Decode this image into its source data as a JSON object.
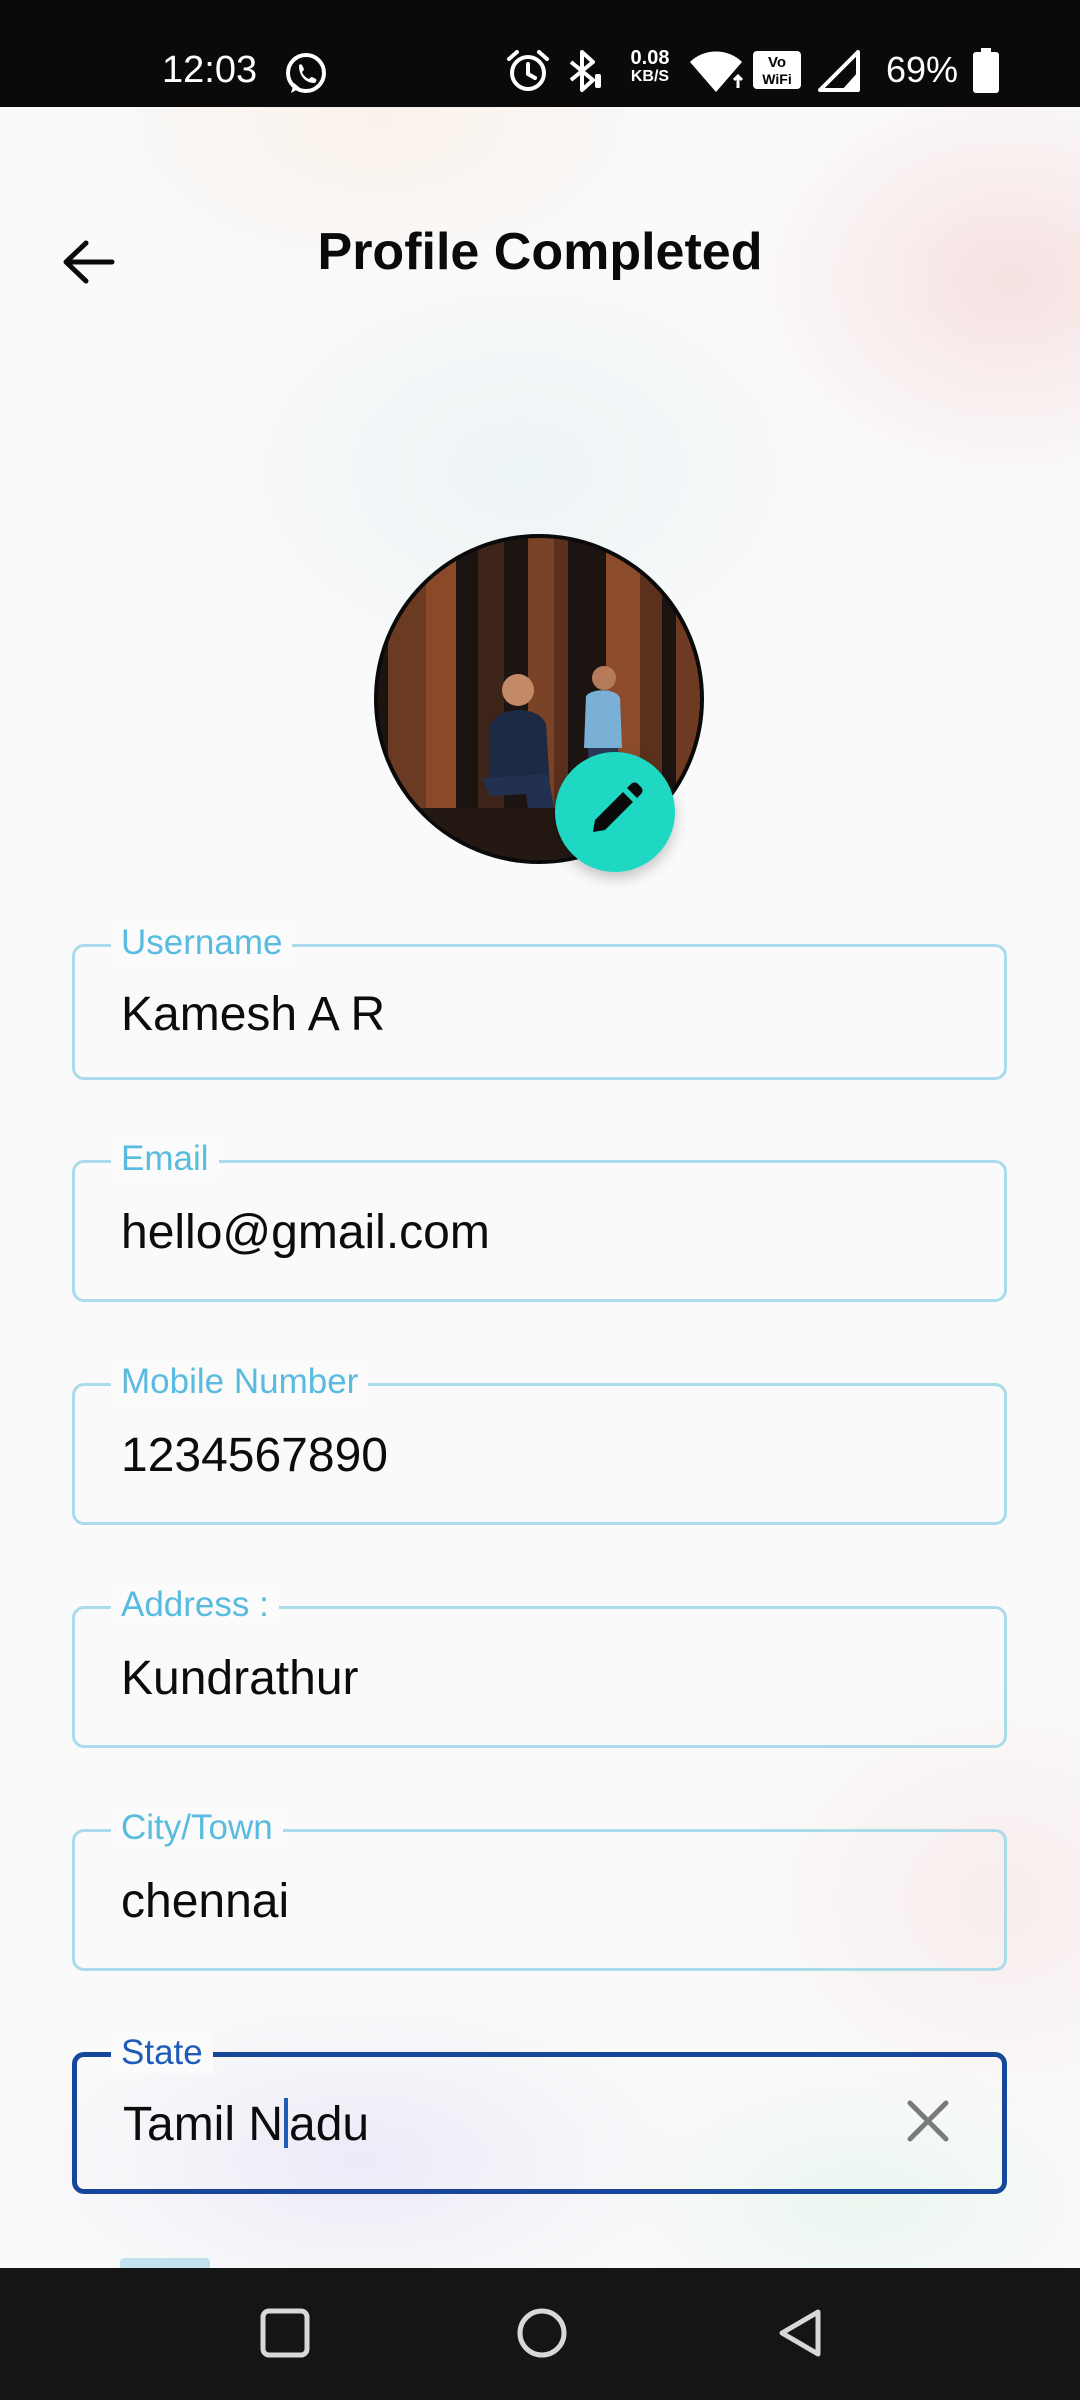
{
  "status_bar": {
    "time": "12:03",
    "net_speed_value": "0.08",
    "net_speed_unit": "KB/S",
    "battery_percent": "69%",
    "icons": [
      "whatsapp-icon",
      "alarm-icon",
      "bluetooth-icon",
      "wifi-icon",
      "vowifi-icon",
      "signal-icon",
      "battery-icon"
    ],
    "vowifi_top": "Vo",
    "vowifi_bottom": "WiFi"
  },
  "header": {
    "title": "Profile Completed",
    "back_icon": "arrow-left-icon"
  },
  "avatar": {
    "edit_icon": "pencil-icon",
    "edit_button_color": "#1ed8c4"
  },
  "form": {
    "fields": [
      {
        "label": "Username",
        "value": "Kamesh A R"
      },
      {
        "label": "Email",
        "value": "hello@gmail.com"
      },
      {
        "label": "Mobile Number",
        "value": "1234567890"
      },
      {
        "label": "Address :",
        "value": "Kundrathur"
      },
      {
        "label": "City/Town",
        "value": "chennai"
      },
      {
        "label": "State",
        "value_before_cursor": "Tamil N",
        "value_after_cursor": "adu",
        "focused": true,
        "clear_icon": "close-icon"
      }
    ],
    "label_color": "#58bbdf",
    "border_color": "#a9dbea",
    "focused_border_color": "#17479a"
  },
  "nav_bar": {
    "buttons": [
      "recents-square-icon",
      "home-circle-icon",
      "back-triangle-icon"
    ]
  }
}
